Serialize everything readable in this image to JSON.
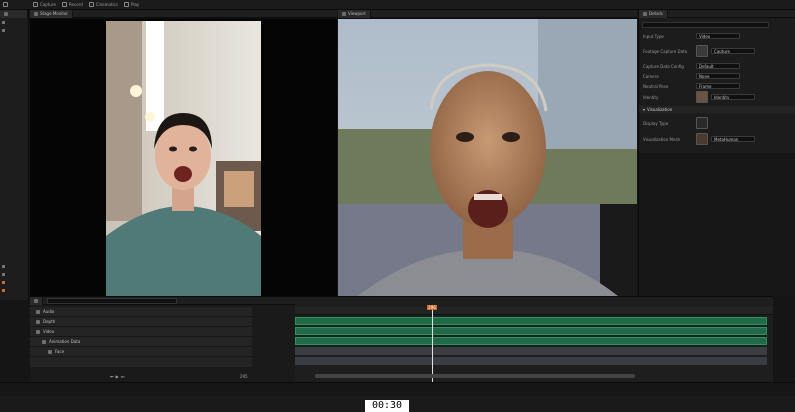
{
  "colors": {
    "accent": "#d06a1c",
    "track_bar": "#1f6b47",
    "playhead": "#e0e0e0"
  },
  "toolbar": {
    "items": [
      {
        "label": "Capture",
        "icon": "camera-icon"
      },
      {
        "label": "Record",
        "icon": "record-icon"
      },
      {
        "label": "Cinematics",
        "icon": "clapper-icon"
      },
      {
        "label": "Play",
        "icon": "play-icon"
      }
    ]
  },
  "left_viewer": {
    "tab": "Stage Monitor"
  },
  "right_viewer": {
    "tab": "Viewport"
  },
  "details": {
    "tab": "Details",
    "props": [
      {
        "label": "Input Type",
        "value": "Video"
      },
      {
        "label": "Footage Capture Data",
        "value": "Capture"
      },
      {
        "label": "Capture Data Config",
        "value": "Default"
      },
      {
        "label": "Camera",
        "value": "None"
      },
      {
        "label": "Neutral Pose",
        "value": "Frame"
      },
      {
        "label": "Identity",
        "value": "Identity"
      }
    ],
    "section": "Visualization",
    "viz_props": [
      {
        "label": "Display Type",
        "value": ""
      },
      {
        "label": "Visualization Mesh",
        "value": "MetaHuman"
      }
    ]
  },
  "sequencer": {
    "tracks": [
      "Audio",
      "Depth",
      "Video",
      "Animation Data",
      "Face"
    ],
    "current_frame": "296",
    "frame_end": "295"
  },
  "timestamp": "00:30"
}
